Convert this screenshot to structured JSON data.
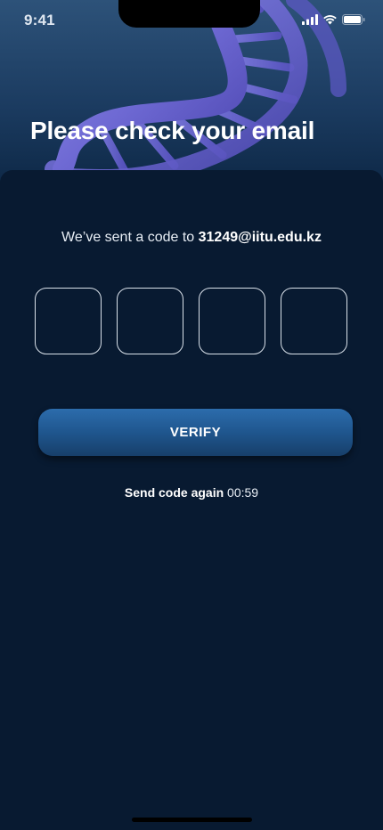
{
  "status_bar": {
    "time": "9:41"
  },
  "header": {
    "title": "Please check your email"
  },
  "message": {
    "prefix": "We’ve sent a code to",
    "email": "31249@iitu.edu.kz"
  },
  "code_inputs": [
    "",
    "",
    "",
    ""
  ],
  "verify_button": {
    "label": "VERIFY"
  },
  "resend": {
    "label": "Send code again",
    "timer": "00:59"
  },
  "colors": {
    "background": "#081a31",
    "button": "#1f568e",
    "text": "#ffffff"
  },
  "icons": [
    "cellular-signal-icon",
    "wifi-icon",
    "battery-icon",
    "dna-helix-image"
  ]
}
